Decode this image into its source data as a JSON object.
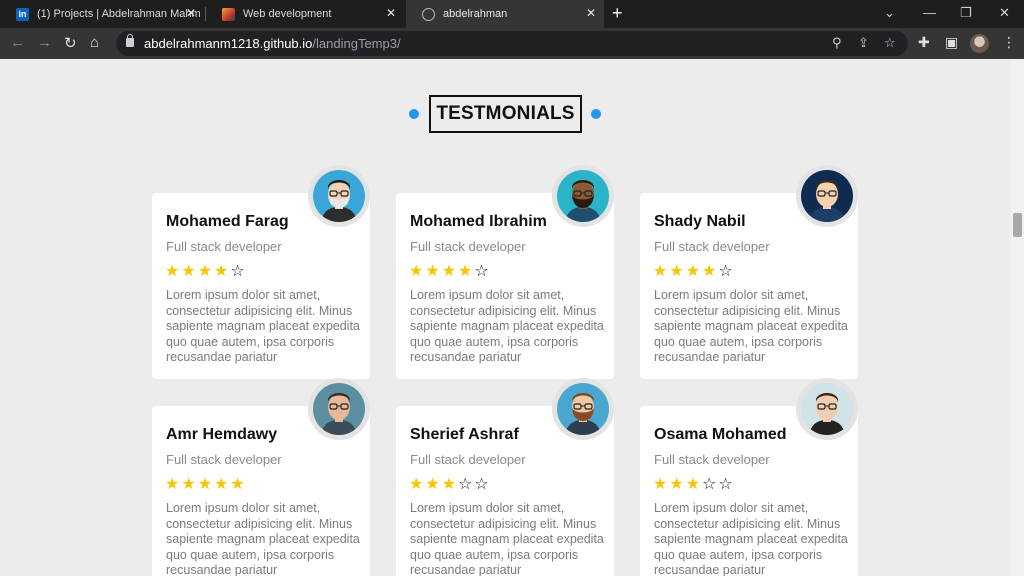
{
  "browser": {
    "tabs": [
      {
        "title": "(1) Projects | Abdelrahman Mahm",
        "favicon": "linkedin-icon"
      },
      {
        "title": "Web development",
        "favicon": "image-favicon-icon"
      },
      {
        "title": "abdelrahman",
        "favicon": "globe-icon"
      }
    ],
    "url_host": "abdelrahmanm1218.github.io",
    "url_path": "/landingTemp3/"
  },
  "section": {
    "title": "TESTMONIALS",
    "accent_color": "#2196f3"
  },
  "testimonials": [
    {
      "name": "Mohamed Farag",
      "role": "Full stack developer",
      "rating": 4,
      "text": "Lorem ipsum dolor sit amet, consectetur adipisicing elit. Minus sapiente magnam placeat expedita quo quae autem, ipsa corporis recusandae pariatur",
      "avatar": "avatar-beard-glasses-icon"
    },
    {
      "name": "Mohamed Ibrahim",
      "role": "Full stack developer",
      "rating": 4,
      "text": "Lorem ipsum dolor sit amet, consectetur adipisicing elit. Minus sapiente magnam placeat expedita quo quae autem, ipsa corporis recusandae pariatur",
      "avatar": "avatar-sunglasses-icon"
    },
    {
      "name": "Shady Nabil",
      "role": "Full stack developer",
      "rating": 4,
      "text": "Lorem ipsum dolor sit amet, consectetur adipisicing elit. Minus sapiente magnam placeat expedita quo quae autem, ipsa corporis recusandae pariatur",
      "avatar": "avatar-glasses-icon"
    },
    {
      "name": "Amr Hemdawy",
      "role": "Full stack developer",
      "rating": 5,
      "text": "Lorem ipsum dolor sit amet, consectetur adipisicing elit. Minus sapiente magnam placeat expedita quo quae autem, ipsa corporis recusandae pariatur",
      "avatar": "avatar-pink-glasses-icon"
    },
    {
      "name": "Sherief Ashraf",
      "role": "Full stack developer",
      "rating": 3,
      "text": "Lorem ipsum dolor sit amet, consectetur adipisicing elit. Minus sapiente magnam placeat expedita quo quae autem, ipsa corporis recusandae pariatur",
      "avatar": "avatar-beard-icon"
    },
    {
      "name": "Osama Mohamed",
      "role": "Full stack developer",
      "rating": 3,
      "text": "Lorem ipsum dolor sit amet, consectetur adipisicing elit. Minus sapiente magnam placeat expedita quo quae autem, ipsa corporis recusandae pariatur",
      "avatar": "avatar-aviator-icon"
    }
  ]
}
